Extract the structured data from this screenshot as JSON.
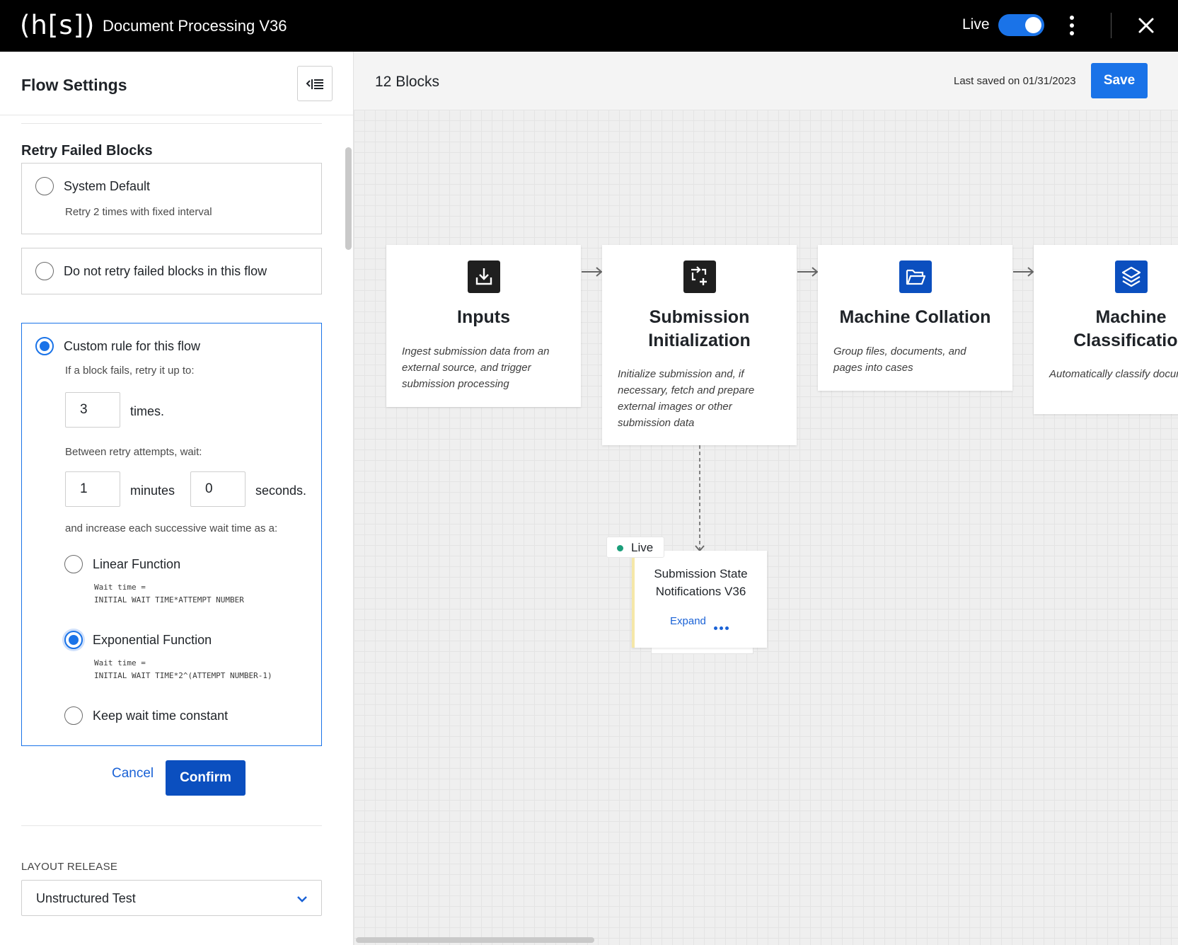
{
  "app": {
    "logo": "(h[s])",
    "title": "Document Processing V36",
    "live_label": "Live",
    "live_enabled": true
  },
  "sidebar": {
    "title": "Flow Settings",
    "section_title": "Retry Failed Blocks",
    "options": {
      "system_default": {
        "label": "System Default",
        "sub": "Retry 2 times with fixed interval",
        "selected": false
      },
      "no_retry": {
        "label": "Do not retry failed blocks in this flow",
        "selected": false
      },
      "custom": {
        "label": "Custom rule for this flow",
        "selected": true,
        "retry_prompt": "If a block fails, retry it up to:",
        "times_value": "3",
        "times_unit": "times.",
        "wait_prompt": "Between retry attempts, wait:",
        "minutes_value": "1",
        "minutes_unit": "minutes",
        "seconds_value": "0",
        "seconds_unit": "seconds.",
        "increase_prompt": "and increase each successive wait time as a:",
        "functions": {
          "linear": {
            "label": "Linear Function",
            "formula_1": "Wait time =",
            "formula_2": "INITIAL WAIT TIME*ATTEMPT NUMBER",
            "selected": false
          },
          "exponential": {
            "label": "Exponential Function",
            "formula_1": "Wait time =",
            "formula_2": "INITIAL WAIT TIME*2^(ATTEMPT NUMBER-1)",
            "selected": true
          },
          "constant": {
            "label": "Keep wait time constant",
            "selected": false
          }
        }
      }
    },
    "cancel_label": "Cancel",
    "confirm_label": "Confirm",
    "layout_release_label": "LAYOUT RELEASE",
    "layout_release_value": "Unstructured Test"
  },
  "canvas": {
    "blocks_count": "12 Blocks",
    "last_saved": "Last saved on 01/31/2023",
    "save_label": "Save",
    "blocks": [
      {
        "title": "Inputs",
        "description": "Ingest submission data from an external source, and trigger submission processing",
        "icon": "download-icon",
        "icon_color": "#1f1f1f"
      },
      {
        "title_1": "Submission",
        "title_2": "Initialization",
        "description": "Initialize submission and, if necessary, fetch and prepare external images or other submission data",
        "icon": "transform-add-icon",
        "icon_color": "#1f1f1f"
      },
      {
        "title": "Machine Collation",
        "description": "Group files, documents, and pages into cases",
        "icon": "folder-open-icon",
        "icon_color": "#0b4fbf"
      },
      {
        "title_1": "Machine",
        "title_2": "Classification",
        "description": "Automatically classify documents",
        "icon": "layers-icon",
        "icon_color": "#0b4fbf"
      }
    ],
    "sub_flow": {
      "status": "Live",
      "status_color": "#1a9e7a",
      "title_1": "Submission State",
      "title_2": "Notifications V36",
      "expand_label": "Expand"
    }
  },
  "colors": {
    "accent": "#1a73e8",
    "confirm": "#0b4fbf",
    "topbar": "#000000"
  }
}
